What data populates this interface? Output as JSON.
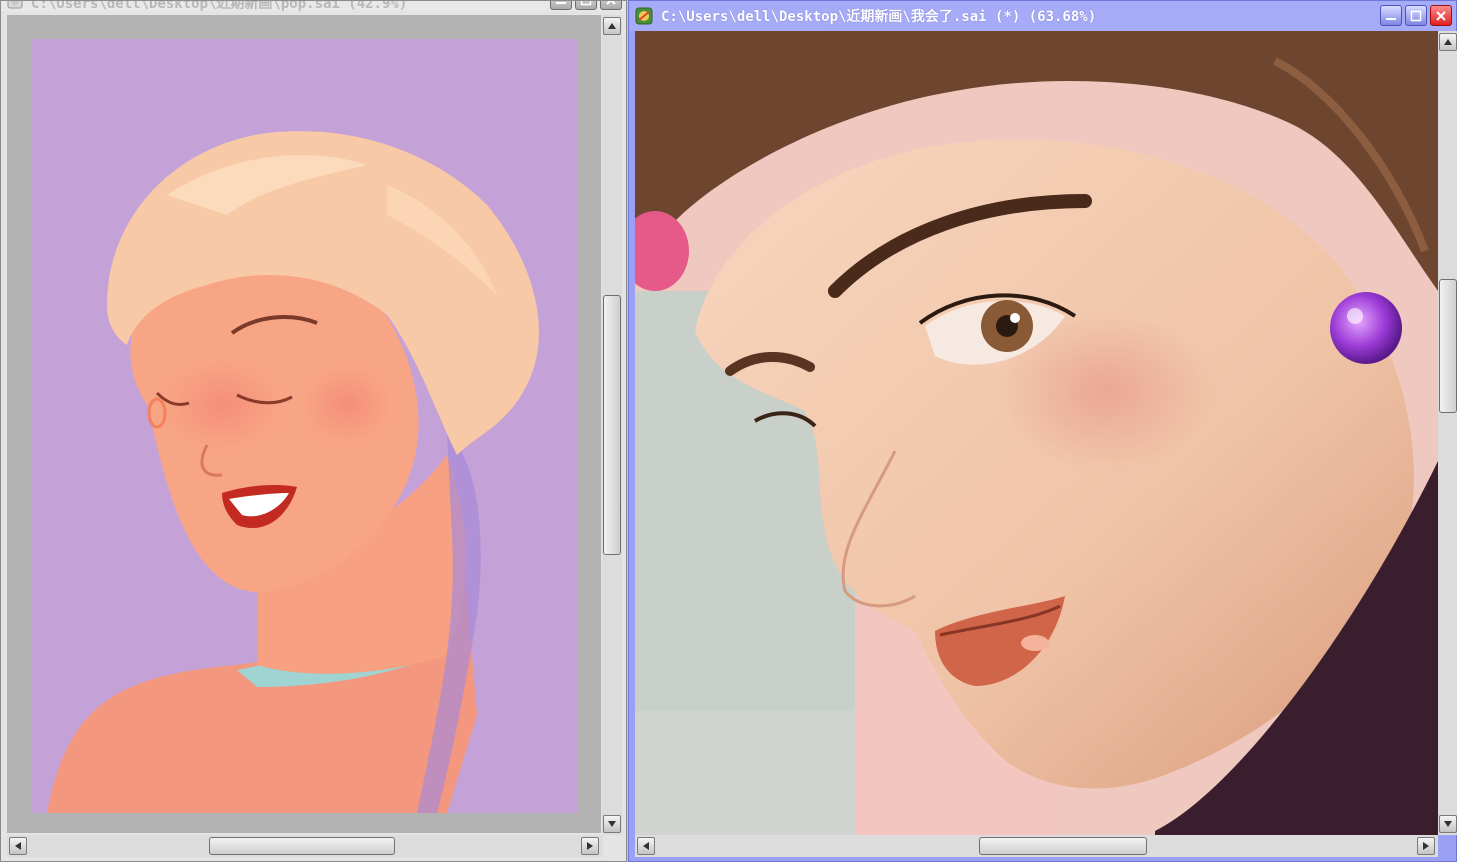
{
  "left_window": {
    "title": "C:\\Users\\dell\\Desktop\\近期新画\\pop.sai (42.9%)",
    "scrollbars": {
      "vertical_position": 0.45,
      "horizontal_position": 0.35
    }
  },
  "right_window": {
    "title": "C:\\Users\\dell\\Desktop\\近期新画\\我会了.sai (*) (63.68%)",
    "scrollbars": {
      "vertical_position": 0.3,
      "horizontal_position": 0.55
    }
  },
  "icons": {
    "app": "sai-app-icon",
    "minimize": "minimize-icon",
    "maximize": "maximize-icon",
    "close": "close-icon",
    "arrow_up": "arrow-up-icon",
    "arrow_down": "arrow-down-icon",
    "arrow_left": "arrow-left-icon",
    "arrow_right": "arrow-right-icon"
  },
  "colors": {
    "active_title_bar": "#a6abf8",
    "inactive_title_bar": "#e8e8e8",
    "close_button": "#e01f1f",
    "left_canvas_background": "#c4a2d8",
    "right_canvas_background": "#e8c2aa"
  }
}
